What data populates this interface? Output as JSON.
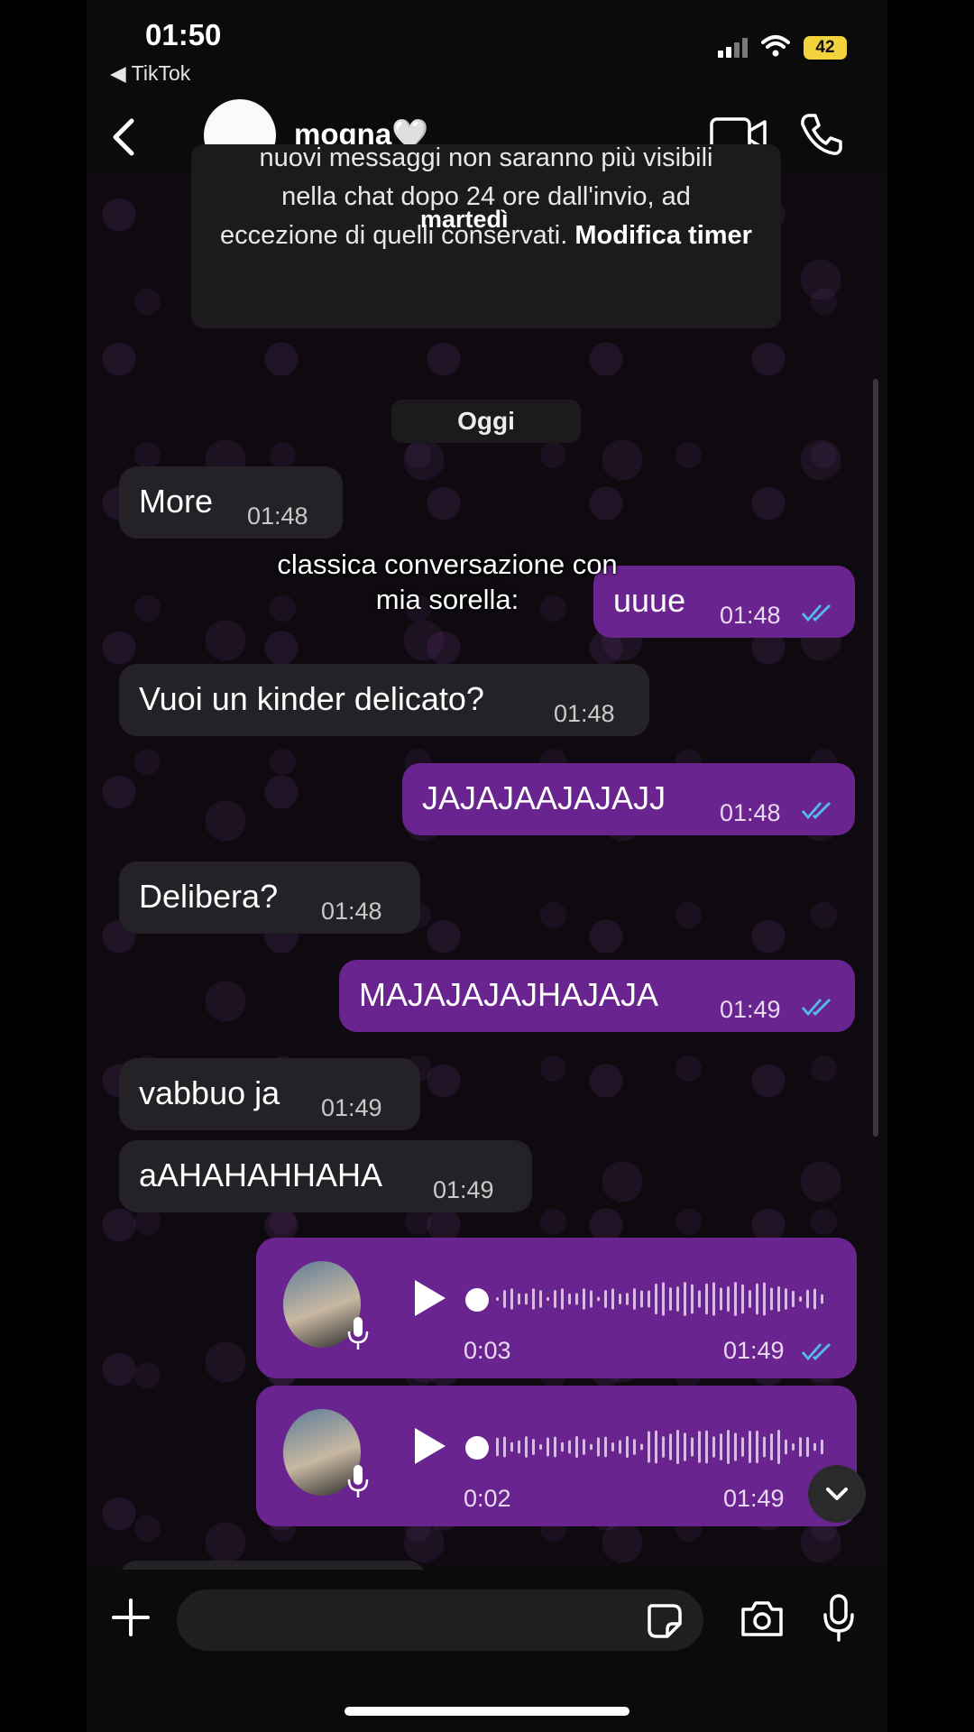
{
  "status_bar": {
    "time": "01:50",
    "back_app": "◀ TikTok",
    "battery": "42"
  },
  "header": {
    "contact_name": "mogna🤍"
  },
  "notice": {
    "line1": "nuovi messaggi non saranno più visibili",
    "line2": "nella chat dopo 24 ore dall'invio, ad",
    "line3": "eccezione di quelli conservati.",
    "link": "Modifica timer"
  },
  "day_sticky": "martedì",
  "day_separator": "Oggi",
  "caption": {
    "line1": "classica conversazione con",
    "line2": "mia sorella:"
  },
  "messages": [
    {
      "dir": "in",
      "text": "More",
      "time": "01:48"
    },
    {
      "dir": "out",
      "text": "uuue",
      "time": "01:48"
    },
    {
      "dir": "in",
      "text": "Vuoi un kinder delicato?",
      "time": "01:48"
    },
    {
      "dir": "out",
      "text": "JAJAJAAJAJAJJ",
      "time": "01:48"
    },
    {
      "dir": "in",
      "text": "Delibera?",
      "time": "01:48"
    },
    {
      "dir": "out",
      "text": "MAJAJAJAJHAJAJA",
      "time": "01:49"
    },
    {
      "dir": "in",
      "text": "vabbuo ja",
      "time": "01:49"
    },
    {
      "dir": "in",
      "text": "aAHAHAHHAHA",
      "time": "01:49"
    }
  ],
  "voice_notes": [
    {
      "duration": "0:03",
      "time": "01:49"
    },
    {
      "duration": "0:02",
      "time": "01:49"
    }
  ],
  "colors": {
    "out_bubble": "#6a2490",
    "in_bubble": "#242226",
    "read_ticks": "#53bdeb"
  },
  "icons": [
    "back-arrow-icon",
    "video-call-icon",
    "phone-call-icon",
    "plus-icon",
    "sticker-icon",
    "camera-icon",
    "microphone-icon",
    "play-icon",
    "chevron-down-icon"
  ]
}
